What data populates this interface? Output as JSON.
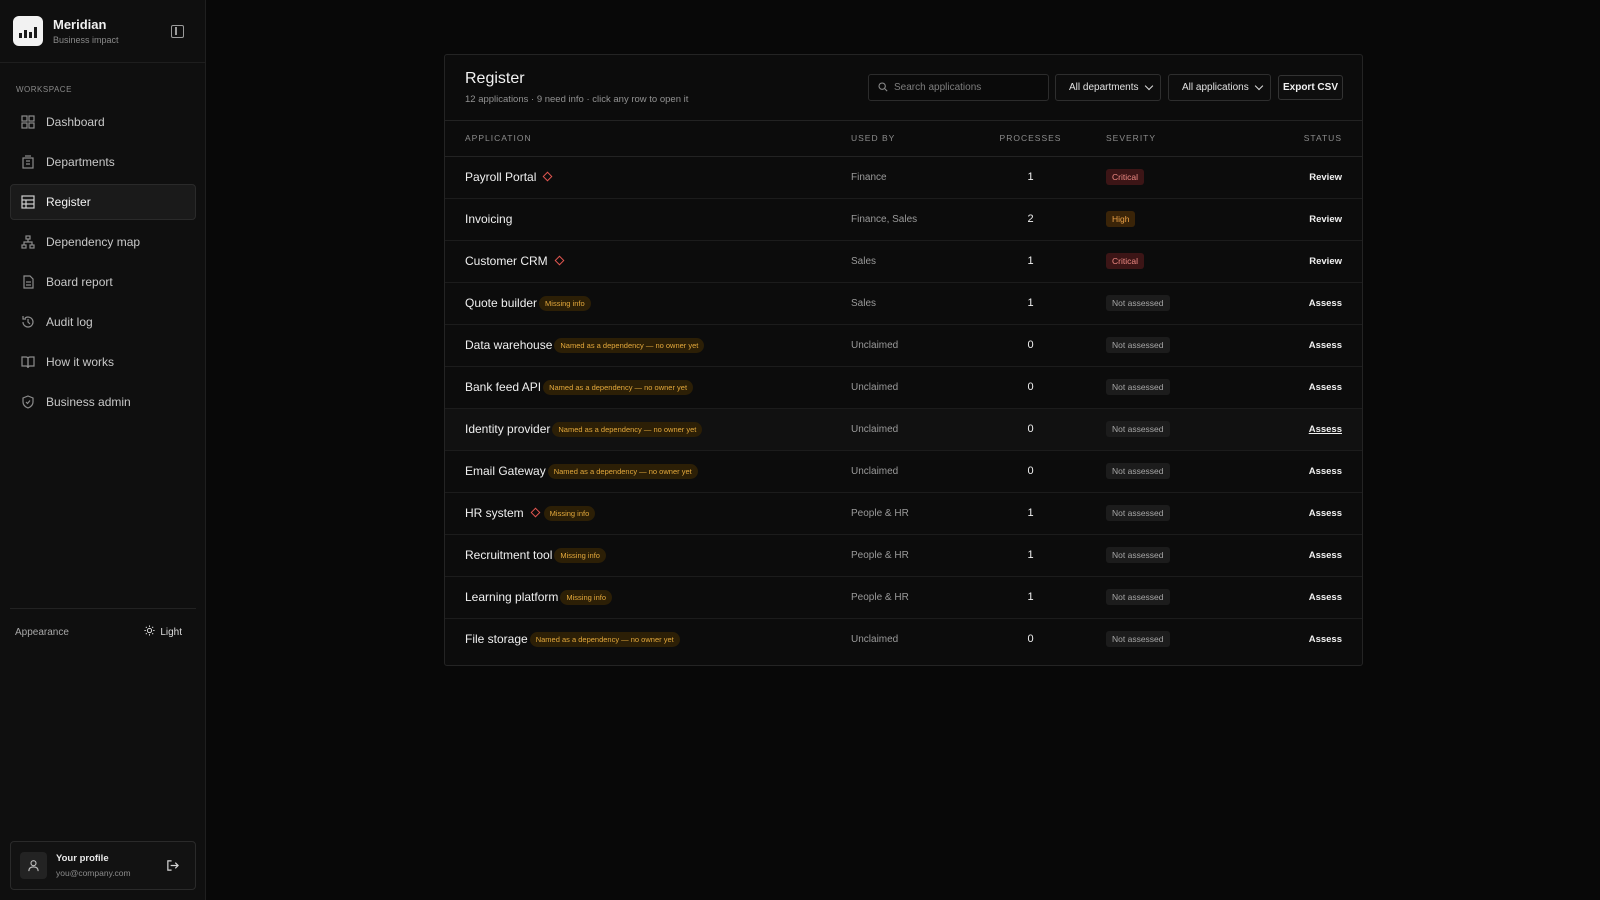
{
  "brand": {
    "name": "Meridian",
    "subtitle": "Business impact"
  },
  "sidebar": {
    "section_label": "WORKSPACE",
    "items": [
      {
        "label": "Dashboard",
        "icon": "grid-icon",
        "active": false
      },
      {
        "label": "Departments",
        "icon": "building-icon",
        "active": false
      },
      {
        "label": "Register",
        "icon": "table-icon",
        "active": true
      },
      {
        "label": "Dependency map",
        "icon": "network-icon",
        "active": false
      },
      {
        "label": "Board report",
        "icon": "file-text-icon",
        "active": false
      },
      {
        "label": "Audit log",
        "icon": "history-icon",
        "active": false
      },
      {
        "label": "How it works",
        "icon": "book-icon",
        "active": false
      },
      {
        "label": "Business admin",
        "icon": "shield-check-icon",
        "active": false
      }
    ],
    "appearance_label": "Appearance",
    "appearance_value": "Light",
    "profile": {
      "name": "Your profile",
      "email": "you@company.com"
    }
  },
  "register": {
    "title": "Register",
    "subtitle": "12 applications · 9 need info · click any row to open it",
    "search_placeholder": "Search applications",
    "department_filter": "All departments",
    "application_filter": "All applications",
    "export_label": "Export CSV",
    "columns": [
      "APPLICATION",
      "USED BY",
      "PROCESSES",
      "SEVERITY",
      "STATUS"
    ],
    "rows": [
      {
        "name": "Payroll Portal",
        "critical_marker": true,
        "tag": "",
        "used_by": "Finance",
        "processes": "1",
        "severity": "Critical",
        "status": "Review"
      },
      {
        "name": "Invoicing",
        "critical_marker": false,
        "tag": "",
        "used_by": "Finance, Sales",
        "processes": "2",
        "severity": "High",
        "status": "Review"
      },
      {
        "name": "Customer CRM",
        "critical_marker": true,
        "tag": "",
        "used_by": "Sales",
        "processes": "1",
        "severity": "Critical",
        "status": "Review"
      },
      {
        "name": "Quote builder",
        "critical_marker": false,
        "tag": "Missing info",
        "used_by": "Sales",
        "processes": "1",
        "severity": "Not assessed",
        "status": "Assess"
      },
      {
        "name": "Data warehouse",
        "critical_marker": false,
        "tag": "Named as a dependency — no owner yet",
        "used_by": "Unclaimed",
        "processes": "0",
        "severity": "Not assessed",
        "status": "Assess"
      },
      {
        "name": "Bank feed API",
        "critical_marker": false,
        "tag": "Named as a dependency — no owner yet",
        "used_by": "Unclaimed",
        "processes": "0",
        "severity": "Not assessed",
        "status": "Assess"
      },
      {
        "name": "Identity provider",
        "critical_marker": false,
        "tag": "Named as a dependency — no owner yet",
        "used_by": "Unclaimed",
        "processes": "0",
        "severity": "Not assessed",
        "status": "Assess"
      },
      {
        "name": "Email Gateway",
        "critical_marker": false,
        "tag": "Named as a dependency — no owner yet",
        "used_by": "Unclaimed",
        "processes": "0",
        "severity": "Not assessed",
        "status": "Assess"
      },
      {
        "name": "HR system",
        "critical_marker": true,
        "tag": "Missing info",
        "used_by": "People & HR",
        "processes": "1",
        "severity": "Not assessed",
        "status": "Assess"
      },
      {
        "name": "Recruitment tool",
        "critical_marker": false,
        "tag": "Missing info",
        "used_by": "People & HR",
        "processes": "1",
        "severity": "Not assessed",
        "status": "Assess"
      },
      {
        "name": "Learning platform",
        "critical_marker": false,
        "tag": "Missing info",
        "used_by": "People & HR",
        "processes": "1",
        "severity": "Not assessed",
        "status": "Assess"
      },
      {
        "name": "File storage",
        "critical_marker": false,
        "tag": "Named as a dependency — no owner yet",
        "used_by": "Unclaimed",
        "processes": "0",
        "severity": "Not assessed",
        "status": "Assess"
      }
    ]
  },
  "colors": {
    "background": "#080808",
    "critical": "#f08a84",
    "high": "#eda247",
    "tag": "#e3a83b"
  }
}
